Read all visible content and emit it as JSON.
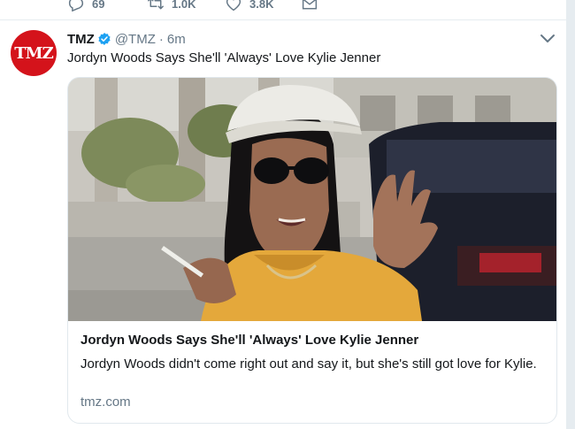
{
  "previous_tweet": {
    "reply_count": "69",
    "retweet_count": "1.0K",
    "like_count": "3.8K"
  },
  "tweet": {
    "avatar_text": "TMZ",
    "name": "TMZ",
    "handle": "@TMZ",
    "separator": "·",
    "time": "6m",
    "text": "Jordyn Woods Says She'll 'Always' Love Kylie Jenner",
    "card": {
      "title": "Jordyn Woods Says She'll 'Always' Love Kylie Jenner",
      "description": "Jordyn Woods didn't come right out and say it, but she's still got love for Kylie.",
      "domain": "tmz.com"
    }
  },
  "colors": {
    "accent": "#1da1f2",
    "muted": "#657786",
    "brand_red": "#d4131b"
  },
  "icons": [
    "reply-icon",
    "retweet-icon",
    "like-icon",
    "direct-message-icon",
    "verified-badge-icon",
    "chevron-down-icon"
  ]
}
